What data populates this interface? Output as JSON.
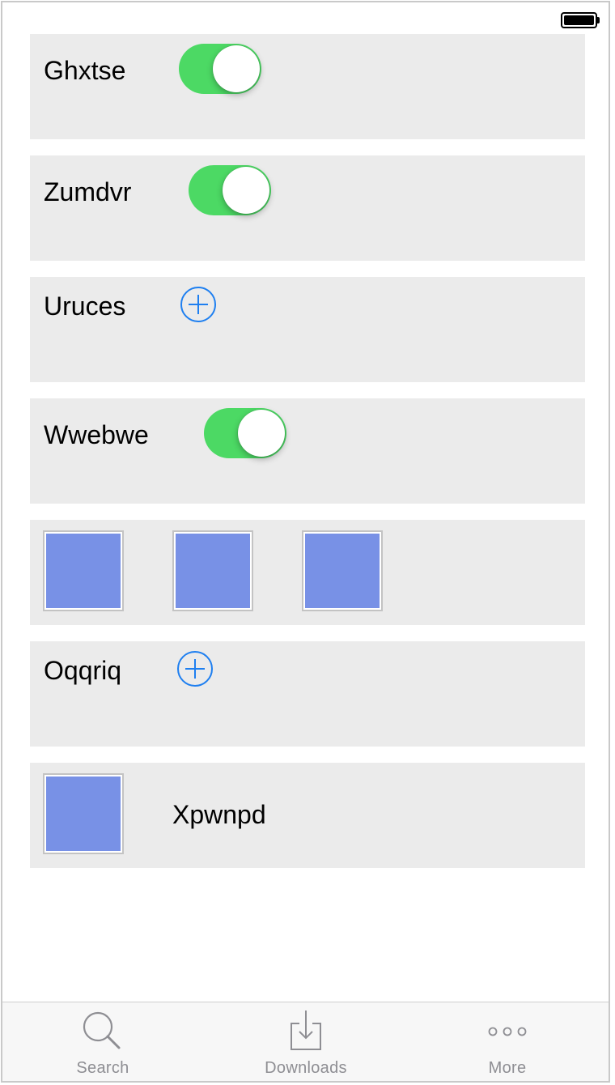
{
  "status_bar": {
    "battery_icon": "battery-full-icon"
  },
  "rows": [
    {
      "label": "Ghxtse",
      "control": "toggle",
      "on": true
    },
    {
      "label": "Zumdvr",
      "control": "toggle",
      "on": true
    },
    {
      "label": "Uruces",
      "control": "add-icon"
    },
    {
      "label": "Wwebwe",
      "control": "toggle",
      "on": true
    },
    {
      "control": "image-row",
      "image_count": 3
    },
    {
      "label": "Oqqriq",
      "control": "add-icon"
    },
    {
      "label": "Xpwnpd",
      "control": "image-with-label"
    }
  ],
  "tab_bar": {
    "items": [
      {
        "label": "Search",
        "icon": "search-icon"
      },
      {
        "label": "Downloads",
        "icon": "download-icon"
      },
      {
        "label": "More",
        "icon": "more-icon"
      }
    ]
  },
  "colors": {
    "toggle_on": "#4cd964",
    "add_icon": "#1e7ff0",
    "image_placeholder": "#7891e6",
    "row_background": "#ebebeb",
    "tab_inactive": "#8e8e93"
  }
}
